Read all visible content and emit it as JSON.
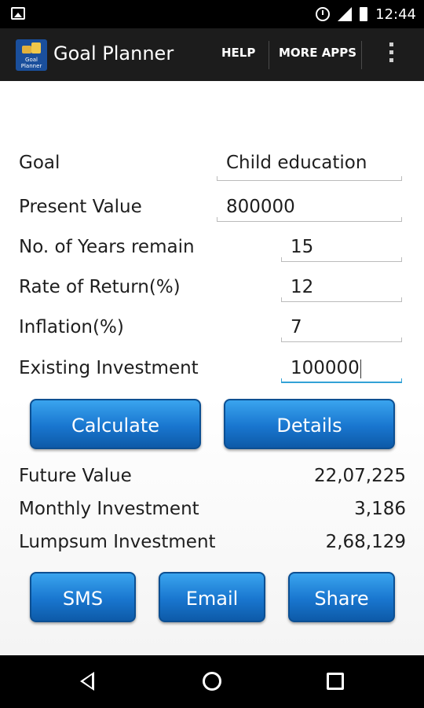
{
  "status_bar": {
    "time": "12:44"
  },
  "app": {
    "title": "Goal Planner",
    "icon_label": "Goal Planner"
  },
  "action_bar": {
    "help": "HELP",
    "more_apps": "MORE APPS"
  },
  "form": {
    "goal": {
      "label": "Goal",
      "value": "Child education"
    },
    "present_value": {
      "label": "Present Value",
      "value": "800000"
    },
    "years": {
      "label": "No. of Years remain",
      "value": "15"
    },
    "rate": {
      "label": "Rate of Return(%)",
      "value": "12"
    },
    "inflation": {
      "label": "Inflation(%)",
      "value": "7"
    },
    "existing": {
      "label": "Existing Investment",
      "value": "100000"
    }
  },
  "buttons": {
    "calculate": "Calculate",
    "details": "Details",
    "sms": "SMS",
    "email": "Email",
    "share": "Share"
  },
  "results": {
    "future_value": {
      "label": "Future Value",
      "value": "22,07,225"
    },
    "monthly": {
      "label": "Monthly Investment",
      "value": "3,186"
    },
    "lumpsum": {
      "label": "Lumpsum Investment",
      "value": "2,68,129"
    }
  }
}
